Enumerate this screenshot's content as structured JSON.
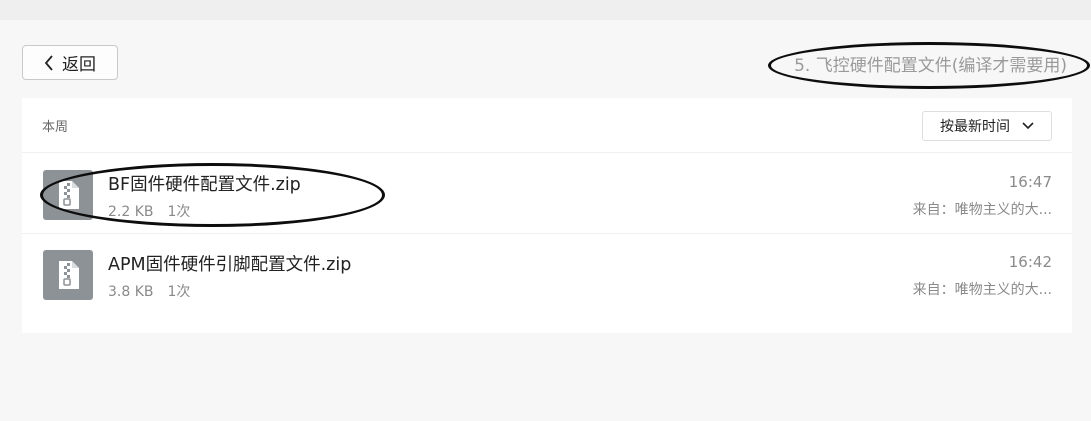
{
  "toolbar": {
    "back_label": "返回",
    "folder_title": "5. 飞控硬件配置文件(编译才需要用)"
  },
  "panel": {
    "group_label": "本周",
    "sort": {
      "selected": "按最新时间"
    }
  },
  "files": [
    {
      "name": "BF固件硬件配置文件.zip",
      "size": "2.2 KB",
      "count": "1次",
      "time": "16:47",
      "source": "来自：唯物主义的大..."
    },
    {
      "name": "APM固件硬件引脚配置文件.zip",
      "size": "3.8 KB",
      "count": "1次",
      "time": "16:42",
      "source": "来自：唯物主义的大..."
    }
  ],
  "colors": {
    "icon_bg": "#8d9296",
    "annotation": "#0d0d0d"
  },
  "icons": {
    "back": "chevron-left-icon",
    "sort": "chevron-down-icon",
    "file": "zip-file-icon"
  }
}
